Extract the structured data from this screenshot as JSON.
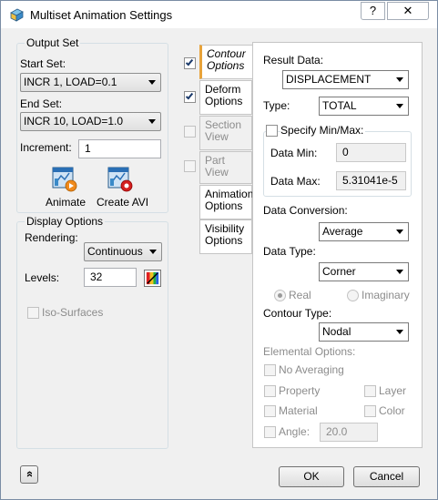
{
  "window": {
    "title": "Multiset Animation Settings",
    "help_label": "?",
    "close_label": "✕"
  },
  "output_set": {
    "legend": "Output Set",
    "start_label": "Start Set:",
    "start_value": "INCR 1, LOAD=0.1",
    "end_label": "End Set:",
    "end_value": "INCR 10, LOAD=1.0",
    "increment_label": "Increment:",
    "increment_value": "1",
    "animate_label": "Animate",
    "create_avi_label": "Create AVI"
  },
  "display_options": {
    "legend": "Display Options",
    "rendering_label": "Rendering:",
    "rendering_value": "Continuous",
    "levels_label": "Levels:",
    "levels_value": "32",
    "iso_label": "Iso-Surfaces"
  },
  "tabs": [
    {
      "label": "Contour Options",
      "checked": true
    },
    {
      "label": "Deform Options",
      "checked": true
    },
    {
      "label": "Section View",
      "checked": false
    },
    {
      "label": "Part View",
      "checked": false
    },
    {
      "label": "Animation Options"
    },
    {
      "label": "Visibility Options"
    }
  ],
  "contour": {
    "result_label": "Result Data:",
    "result_value": "DISPLACEMENT",
    "type_label": "Type:",
    "type_value": "TOTAL",
    "specify_label": "Specify Min/Max:",
    "min_label": "Data Min:",
    "min_value": "0",
    "max_label": "Data Max:",
    "max_value": "5.31041e-5",
    "conversion_label": "Data Conversion:",
    "conversion_value": "Average",
    "datatype_label": "Data Type:",
    "datatype_value": "Corner",
    "real_label": "Real",
    "imaginary_label": "Imaginary",
    "contour_type_label": "Contour Type:",
    "contour_type_value": "Nodal",
    "elemental_label": "Elemental Options:",
    "no_avg_label": "No Averaging",
    "property_label": "Property",
    "layer_label": "Layer",
    "material_label": "Material",
    "color_label": "Color",
    "angle_label": "Angle:",
    "angle_value": "20.0"
  },
  "footer": {
    "expand_label": "»",
    "ok_label": "OK",
    "cancel_label": "Cancel"
  }
}
